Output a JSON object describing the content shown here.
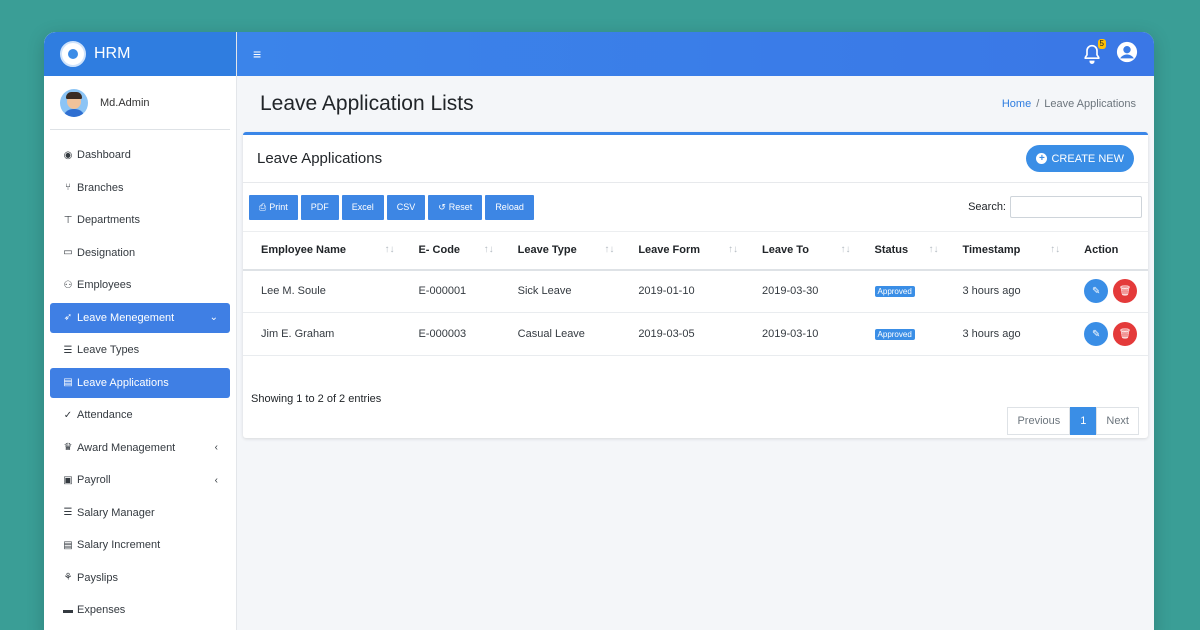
{
  "brand": {
    "name": "HRM"
  },
  "user": {
    "name": "Md.Admin"
  },
  "sidebar": {
    "items": [
      {
        "label": "Dashboard",
        "icon": "dashboard-icon",
        "glyph": "◉"
      },
      {
        "label": "Branches",
        "icon": "branch-icon",
        "glyph": "⑂"
      },
      {
        "label": "Departments",
        "icon": "sitemap-icon",
        "glyph": "⊤"
      },
      {
        "label": "Designation",
        "icon": "id-card-icon",
        "glyph": "▭"
      },
      {
        "label": "Employees",
        "icon": "users-icon",
        "glyph": "⚇"
      },
      {
        "label": "Leave Menegement",
        "icon": "rocket-icon",
        "glyph": "➶",
        "active": true,
        "caret": "⌄"
      },
      {
        "label": "Leave Types",
        "icon": "list-icon",
        "glyph": "☰"
      },
      {
        "label": "Leave Applications",
        "icon": "file-icon",
        "glyph": "▤",
        "active": true
      },
      {
        "label": "Attendance",
        "icon": "user-check-icon",
        "glyph": "✓"
      },
      {
        "label": "Award Menagement",
        "icon": "trophy-icon",
        "glyph": "♛",
        "caret": "‹"
      },
      {
        "label": "Payroll",
        "icon": "money-icon",
        "glyph": "▣",
        "caret": "‹"
      },
      {
        "label": "Salary Manager",
        "icon": "list-icon",
        "glyph": "☰"
      },
      {
        "label": "Salary Increment",
        "icon": "file-icon",
        "glyph": "▤"
      },
      {
        "label": "Payslips",
        "icon": "hand-holding-icon",
        "glyph": "⚘"
      },
      {
        "label": "Expenses",
        "icon": "credit-card-icon",
        "glyph": "▬"
      }
    ]
  },
  "topbar": {
    "menu_glyph": "≡",
    "notification_count": "5"
  },
  "page": {
    "title": "Leave Application Lists"
  },
  "breadcrumb": {
    "home": "Home",
    "separator": "/",
    "current": "Leave Applications"
  },
  "card": {
    "title": "Leave Applications",
    "create_label": "CREATE NEW"
  },
  "toolbar": {
    "buttons": [
      "Print",
      "PDF",
      "Excel",
      "CSV",
      "Reset",
      "Reload"
    ],
    "search_label": "Search:"
  },
  "table": {
    "headers": [
      "Employee Name",
      "E- Code",
      "Leave Type",
      "Leave Form",
      "Leave To",
      "Status",
      "Timestamp",
      "Action"
    ],
    "rows": [
      [
        "Lee M. Soule",
        "E-000001",
        "Sick Leave",
        "2019-01-10",
        "2019-03-30",
        "Approved",
        "3 hours ago"
      ],
      [
        "Jim E. Graham",
        "E-000003",
        "Casual Leave",
        "2019-03-05",
        "2019-03-10",
        "Approved",
        "3 hours ago"
      ]
    ],
    "sort_glyph": "↑↓"
  },
  "footer": {
    "info": "Showing 1 to 2 of 2 entries",
    "pager": {
      "previous": "Previous",
      "current": "1",
      "next": "Next"
    }
  }
}
